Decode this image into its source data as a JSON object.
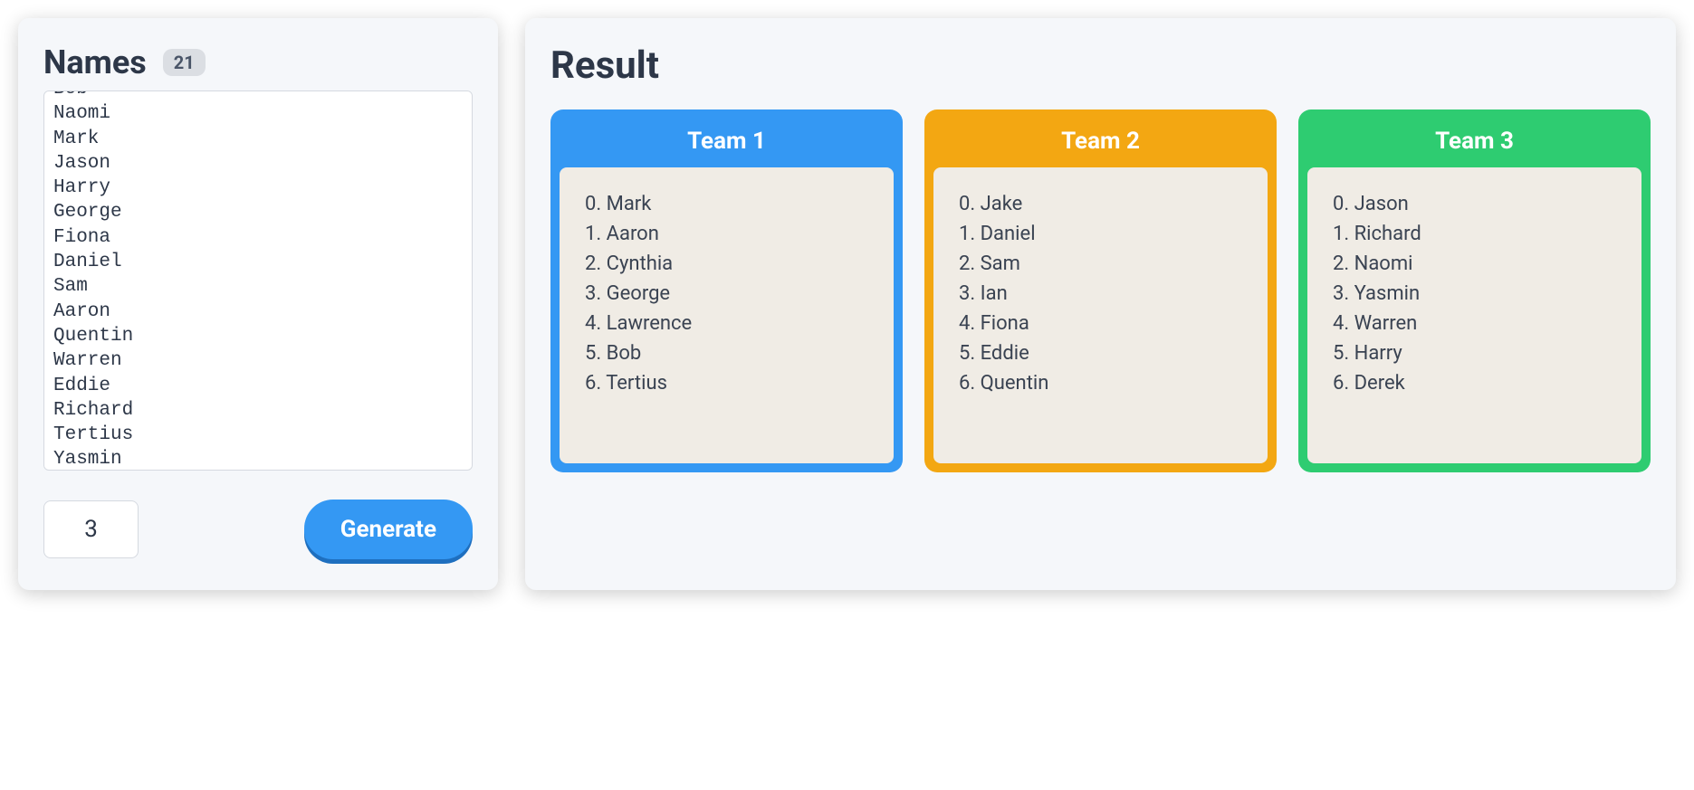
{
  "input": {
    "title": "Names",
    "count": "21",
    "names_text": "Bob\nNaomi\nMark\nJason\nHarry\nGeorge\nFiona\nDaniel\nSam\nAaron\nQuentin\nWarren\nEddie\nRichard\nTertius\nYasmin\nIan",
    "team_count": "3",
    "generate_label": "Generate"
  },
  "result": {
    "title": "Result",
    "teams": [
      {
        "name": "Team 1",
        "color": "team-blue",
        "members": [
          "Mark",
          "Aaron",
          "Cynthia",
          "George",
          "Lawrence",
          "Bob",
          "Tertius"
        ]
      },
      {
        "name": "Team 2",
        "color": "team-orange",
        "members": [
          "Jake",
          "Daniel",
          "Sam",
          "Ian",
          "Fiona",
          "Eddie",
          "Quentin"
        ]
      },
      {
        "name": "Team 3",
        "color": "team-green",
        "members": [
          "Jason",
          "Richard",
          "Naomi",
          "Yasmin",
          "Warren",
          "Harry",
          "Derek"
        ]
      }
    ]
  }
}
